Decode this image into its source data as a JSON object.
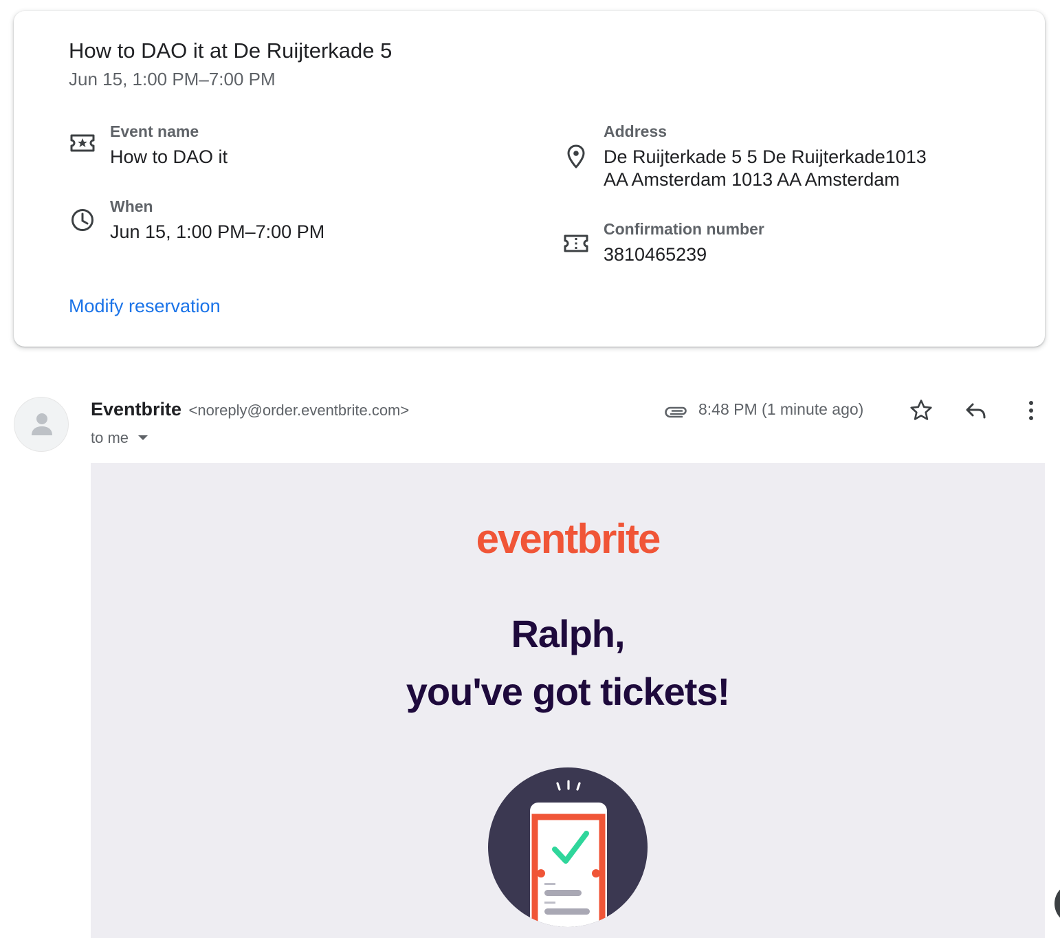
{
  "reservation_card": {
    "title": "How to DAO it at De Ruijterkade 5",
    "subtitle": "Jun 15, 1:00 PM–7:00 PM",
    "event_name": {
      "label": "Event name",
      "value": "How to DAO it",
      "icon": "ticket-star-icon"
    },
    "when": {
      "label": "When",
      "value": "Jun 15, 1:00 PM–7:00 PM",
      "icon": "clock-icon"
    },
    "address": {
      "label": "Address",
      "line1": "De Ruijterkade 5 5 De Ruijterkade1013",
      "line2": "AA Amsterdam 1013 AA Amsterdam",
      "icon": "location-pin-icon"
    },
    "confirmation": {
      "label": "Confirmation number",
      "value": "3810465239",
      "icon": "confirmation-ticket-icon"
    },
    "modify_link": "Modify reservation"
  },
  "email_header": {
    "sender_name": "Eventbrite",
    "sender_email": "<noreply@order.eventbrite.com>",
    "recipient": "to me",
    "timestamp": "8:48 PM (1 minute ago)",
    "icons": [
      "avatar-icon",
      "attachment-icon",
      "star-icon",
      "reply-icon",
      "more-vert-icon"
    ]
  },
  "email_body": {
    "brand": "eventbrite",
    "headline_line1": "Ralph,",
    "headline_line2": "you've got tickets!"
  },
  "colors": {
    "link_blue": "#1a73e8",
    "brand_orange": "#f05537",
    "headline_navy": "#1e0a3c",
    "body_background": "#eeedf2",
    "check_green": "#2fd69b"
  }
}
